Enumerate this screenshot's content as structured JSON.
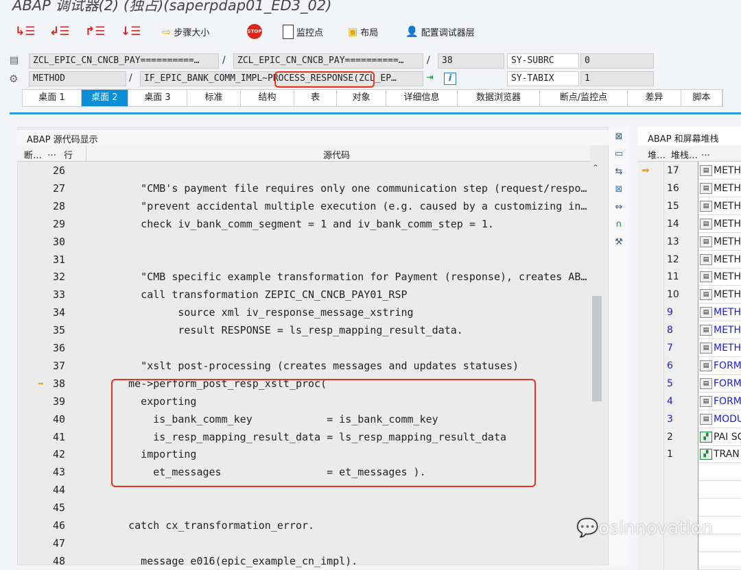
{
  "window": {
    "title": "ABAP 调试器(2) (独占)(saperpdap01_ED3_02)"
  },
  "toolbar": {
    "step_size": "步骤大小",
    "stop": "STOP",
    "watchpoint": "监控点",
    "layout": "布局",
    "config": "配置调试器层"
  },
  "fields": {
    "program": "ZCL_EPIC_CN_CNCB_PAY==========…",
    "include": "ZCL_EPIC_CN_CNCB_PAY==========…",
    "line": "38",
    "event_type": "METHOD",
    "event": "IF_EPIC_BANK_COMM_IMPL~",
    "event_highlight": "PROCESS_RESPONSE",
    "event_rest": "(ZCL_EP…",
    "sy1_name": "SY-SUBRC",
    "sy1_val": "0",
    "sy2_name": "SY-TABIX",
    "sy2_val": "1"
  },
  "tabs": [
    "桌面 1",
    "桌面 2",
    "桌面 3",
    "标准",
    "结构",
    "表",
    "对象",
    "详细信息",
    "数据浏览器",
    "断点/监控点",
    "差异",
    "脚本"
  ],
  "active_tab": 1,
  "source": {
    "title": "ABAP 源代码显示",
    "col_bp": "断…",
    "col_dots": "…",
    "col_line": "行",
    "col_code": "源代码",
    "current_line": 38,
    "lines": [
      {
        "n": "26",
        "c": ""
      },
      {
        "n": "27",
        "c": "      \"CMB's payment file requires only one communication step (request/response…"
      },
      {
        "n": "28",
        "c": "      \"prevent accidental multiple execution (e.g. caused by a customizing incon…"
      },
      {
        "n": "29",
        "c": "      check iv_bank_comm_segment = 1 and iv_bank_comm_step = 1."
      },
      {
        "n": "30",
        "c": ""
      },
      {
        "n": "31",
        "c": ""
      },
      {
        "n": "32",
        "c": "      \"CMB specific example transformation for Payment (response), creates ABAP …"
      },
      {
        "n": "33",
        "c": "      call transformation ZEPIC_CN_CNCB_PAY01_RSP"
      },
      {
        "n": "34",
        "c": "            source xml iv_response_message_xstring"
      },
      {
        "n": "35",
        "c": "            result RESPONSE = ls_resp_mapping_result_data."
      },
      {
        "n": "36",
        "c": ""
      },
      {
        "n": "37",
        "c": "      \"xslt post-processing (creates messages and updates statuses)"
      },
      {
        "n": "38",
        "c": "    me->perform_post_resp_xslt_proc("
      },
      {
        "n": "39",
        "c": "      exporting"
      },
      {
        "n": "40",
        "c": "        is_bank_comm_key            = is_bank_comm_key"
      },
      {
        "n": "41",
        "c": "        is_resp_mapping_result_data = ls_resp_mapping_result_data"
      },
      {
        "n": "42",
        "c": "      importing"
      },
      {
        "n": "43",
        "c": "        et_messages                 = et_messages )."
      },
      {
        "n": "44",
        "c": ""
      },
      {
        "n": "45",
        "c": ""
      },
      {
        "n": "46",
        "c": "    catch cx_transformation_error."
      },
      {
        "n": "47",
        "c": ""
      },
      {
        "n": "48",
        "c": "      message e016(epic_example_cn_impl)."
      }
    ]
  },
  "stack": {
    "title": "ABAP 和屏幕堆栈",
    "col1": "堆…",
    "col2": "堆栈…",
    "col3": "…",
    "rows": [
      {
        "n": "17",
        "t": "METH",
        "blue": false,
        "current": true,
        "kind": "abap"
      },
      {
        "n": "16",
        "t": "METH",
        "blue": false,
        "kind": "abap"
      },
      {
        "n": "15",
        "t": "METH",
        "blue": false,
        "kind": "abap"
      },
      {
        "n": "14",
        "t": "METH",
        "blue": false,
        "kind": "abap"
      },
      {
        "n": "13",
        "t": "METH",
        "blue": false,
        "kind": "abap"
      },
      {
        "n": "12",
        "t": "METH",
        "blue": false,
        "kind": "abap"
      },
      {
        "n": "11",
        "t": "METH",
        "blue": false,
        "kind": "abap"
      },
      {
        "n": "10",
        "t": "METH",
        "blue": false,
        "kind": "abap"
      },
      {
        "n": "9",
        "t": "METH",
        "blue": true,
        "kind": "abap"
      },
      {
        "n": "8",
        "t": "METH",
        "blue": true,
        "kind": "abap"
      },
      {
        "n": "7",
        "t": "METH",
        "blue": true,
        "kind": "abap"
      },
      {
        "n": "6",
        "t": "FORM",
        "blue": true,
        "kind": "abap"
      },
      {
        "n": "5",
        "t": "FORM",
        "blue": true,
        "kind": "abap"
      },
      {
        "n": "4",
        "t": "FORM",
        "blue": true,
        "kind": "abap"
      },
      {
        "n": "3",
        "t": "MODU",
        "blue": true,
        "kind": "abap"
      },
      {
        "n": "2",
        "t": "PAI SC",
        "blue": false,
        "kind": "screen"
      },
      {
        "n": "1",
        "t": "TRAN",
        "blue": false,
        "kind": "screen"
      }
    ]
  },
  "watermark": "osinnovation",
  "colors": {
    "accent": "#0a8fd6",
    "highlight": "#e8321c",
    "arrow": "#f0a81c",
    "link": "#1a1adb"
  }
}
